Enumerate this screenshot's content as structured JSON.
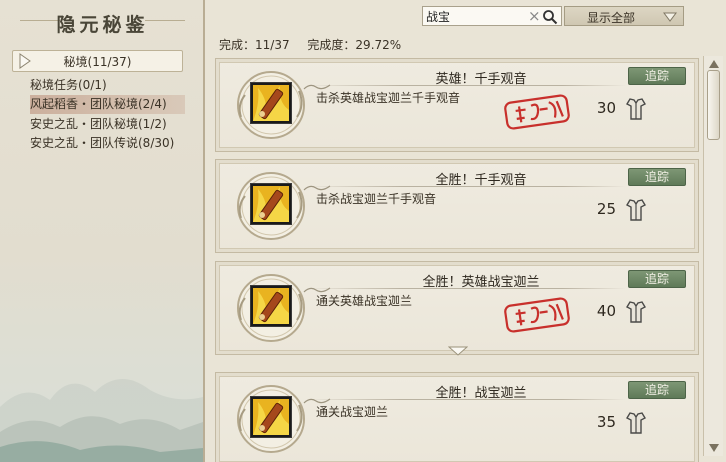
{
  "sidebar": {
    "title": "隐元秘鉴",
    "category": "秘境(11/37)",
    "items": [
      {
        "label": "秘境任务(0/1)",
        "active": false
      },
      {
        "label": "风起稻香・团队秘境(2/4)",
        "active": true
      },
      {
        "label": "安史之乱・团队秘境(1/2)",
        "active": false
      },
      {
        "label": "安史之乱・团队传说(8/30)",
        "active": false
      }
    ]
  },
  "search": {
    "value": "战宝",
    "clear": "×"
  },
  "filter": {
    "selected": "显示全部"
  },
  "status": {
    "completed": "完成：11/37",
    "completion": "完成度：29.72%"
  },
  "colors": {
    "track_button": "#6b8763",
    "stamp": "#c8302c",
    "accent_item": "#c4a08c"
  },
  "achievements": [
    {
      "title": "英雄！千手观音",
      "desc": "击杀英雄战宝迦兰千手观音",
      "points": "30",
      "track": "追踪",
      "completed": true,
      "icon": "golden-scroll-icon"
    },
    {
      "title": "全胜！千手观音",
      "desc": "击杀战宝迦兰千手观音",
      "points": "25",
      "track": "追踪",
      "completed": false,
      "icon": "golden-scroll-icon"
    },
    {
      "title": "全胜！英雄战宝迦兰",
      "desc": "通关英雄战宝迦兰",
      "points": "40",
      "track": "追踪",
      "completed": true,
      "icon": "golden-scroll-icon"
    },
    {
      "title": "全胜！战宝迦兰",
      "desc": "通关战宝迦兰",
      "points": "35",
      "track": "追踪",
      "completed": false,
      "icon": "golden-scroll-icon"
    }
  ]
}
